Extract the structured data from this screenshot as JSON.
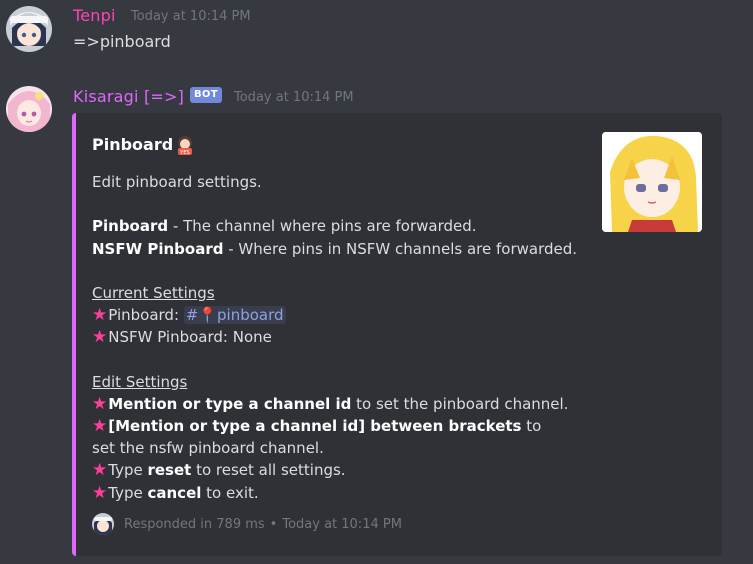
{
  "messages": [
    {
      "author": "Tenpi",
      "author_color": "#ff44b4",
      "timestamp": "Today at 10:14 PM",
      "content": "=>pinboard"
    },
    {
      "author": "Kisaragi [=>]",
      "author_color": "#e066ff",
      "badge": "BOT",
      "timestamp": "Today at 10:14 PM"
    }
  ],
  "embed": {
    "accent_color": "#e066ff",
    "title": "Pinboard",
    "title_emoji": "yes-emoji",
    "desc_intro": "Edit pinboard settings.",
    "pinboard_label": "Pinboard",
    "pinboard_desc": " - The channel where pins are forwarded.",
    "nsfw_label": "NSFW Pinboard",
    "nsfw_desc": " - Where pins in NSFW channels are forwarded.",
    "current_heading": "Current Settings",
    "current_pinboard_prefix": "Pinboard: ",
    "current_pinboard_channel": "#📍pinboard",
    "current_nsfw": "NSFW Pinboard: None",
    "edit_heading": "Edit Settings",
    "edit1_bold": "Mention or type a channel id",
    "edit1_rest": " to set the pinboard channel.",
    "edit2_bold": "[Mention or type a channel id] between brackets",
    "edit2_rest": " to set the nsfw pinboard channel.",
    "edit3_pre": "Type ",
    "edit3_bold": "reset",
    "edit3_rest": " to reset all settings.",
    "edit4_pre": "Type ",
    "edit4_bold": "cancel",
    "edit4_rest": " to exit.",
    "star_glyph": "★",
    "footer_text": "Responded in 789 ms",
    "footer_sep": "•",
    "footer_time": "Today at 10:14 PM"
  }
}
